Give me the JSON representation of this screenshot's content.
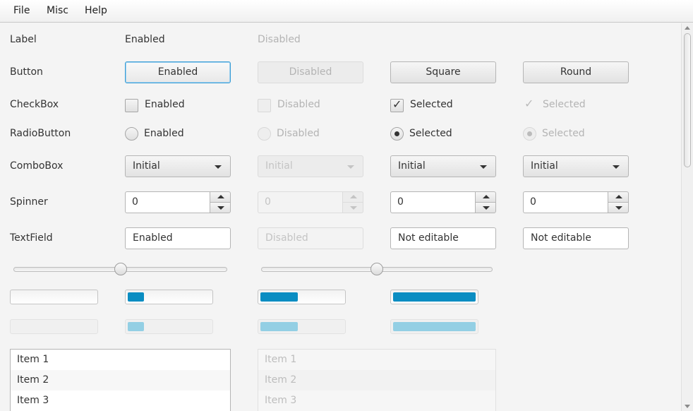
{
  "menu": {
    "file": "File",
    "misc": "Misc",
    "help": "Help"
  },
  "rows": {
    "label": "Label",
    "button": "Button",
    "checkbox": "CheckBox",
    "radiobutton": "RadioButton",
    "combobox": "ComboBox",
    "spinner": "Spinner",
    "textfield": "TextField"
  },
  "labels": {
    "enabled": "Enabled",
    "disabled": "Disabled"
  },
  "buttons": {
    "enabled": "Enabled",
    "disabled": "Disabled",
    "square": "Square",
    "round": "Round"
  },
  "checkboxes": {
    "enabled": "Enabled",
    "disabled": "Disabled",
    "selected": "Selected",
    "selected_disabled": "Selected"
  },
  "radios": {
    "enabled": "Enabled",
    "disabled": "Disabled",
    "selected": "Selected",
    "selected_disabled": "Selected"
  },
  "combos": {
    "c1": "Initial",
    "c2": "Initial",
    "c3": "Initial",
    "c4": "Initial"
  },
  "spinners": {
    "s1": "0",
    "s2": "0",
    "s3": "0",
    "s4": "0"
  },
  "textfields": {
    "enabled": "Enabled",
    "disabled": "Disabled",
    "readonly1": "Not editable",
    "readonly2": "Not editable"
  },
  "sliders": {
    "slider1_value": 0.5,
    "slider2_value": 0.5
  },
  "progress": {
    "enabled": [
      0.0,
      0.2,
      0.45,
      1.0
    ],
    "disabled": [
      0.0,
      0.2,
      0.45,
      1.0
    ]
  },
  "lists": {
    "enabled": [
      "Item 1",
      "Item 2",
      "Item 3"
    ],
    "disabled": [
      "Item 1",
      "Item 2",
      "Item 3"
    ]
  },
  "colors": {
    "accent": "#0a8dc2",
    "accent_disabled": "#93cfe4",
    "focus": "#3b9ed6"
  }
}
